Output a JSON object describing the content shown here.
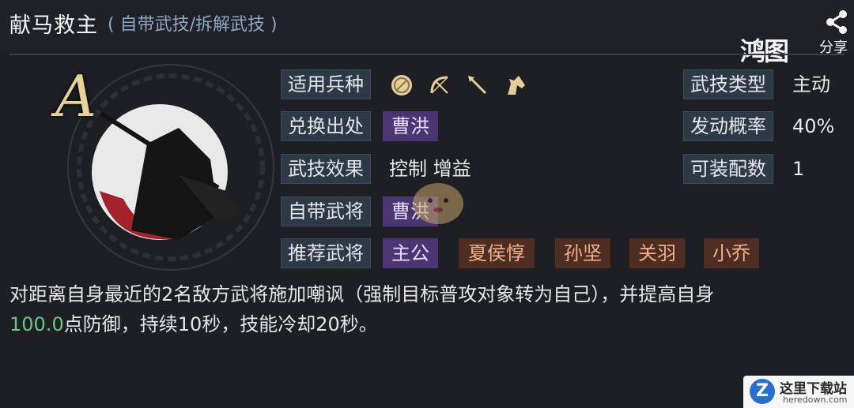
{
  "header": {
    "title": "献马救主",
    "subtitle": "( 自带武技/拆解武技 )"
  },
  "watermark": {
    "brand": "鸿图",
    "share": "分享"
  },
  "skill": {
    "grade": "A",
    "labels": {
      "unit_types": "适用兵种",
      "source": "兑换出处",
      "effect": "武技效果",
      "own_general": "自带武将",
      "recommended": "推荐武将",
      "skill_type": "武技类型",
      "trigger_rate": "发动概率",
      "equip_count": "可装配数"
    },
    "unit_icons": [
      "shield-icon",
      "bow-icon",
      "spear-icon",
      "horse-icon"
    ],
    "source_value": "曹洪",
    "effect_value": "控制 增益",
    "own_general_value": "曹洪",
    "recommended": [
      "主公",
      "夏侯惇",
      "孙坚",
      "关羽",
      "小乔"
    ],
    "skill_type_value": "主动",
    "trigger_rate_value": "40%",
    "equip_count_value": "1"
  },
  "description": {
    "line1": "对距离自身最近的2名敌方武将施加嘲讽（强制目标普攻对象转为自己），并提高自身",
    "number": "100.0",
    "line2": "点防御，持续10秒，技能冷却20秒。"
  },
  "corner_logo": {
    "letter": "Z",
    "brand_cn": "这里下载站",
    "brand_en": "heredown.com"
  },
  "colors": {
    "background": "#1d1f24",
    "label_bg": "#2e3948",
    "tag_purple": "#4a3672",
    "tag_brown": "#4e2e22",
    "highlight_green": "#6cc784",
    "subtitle_blue": "#8fa6c8"
  }
}
